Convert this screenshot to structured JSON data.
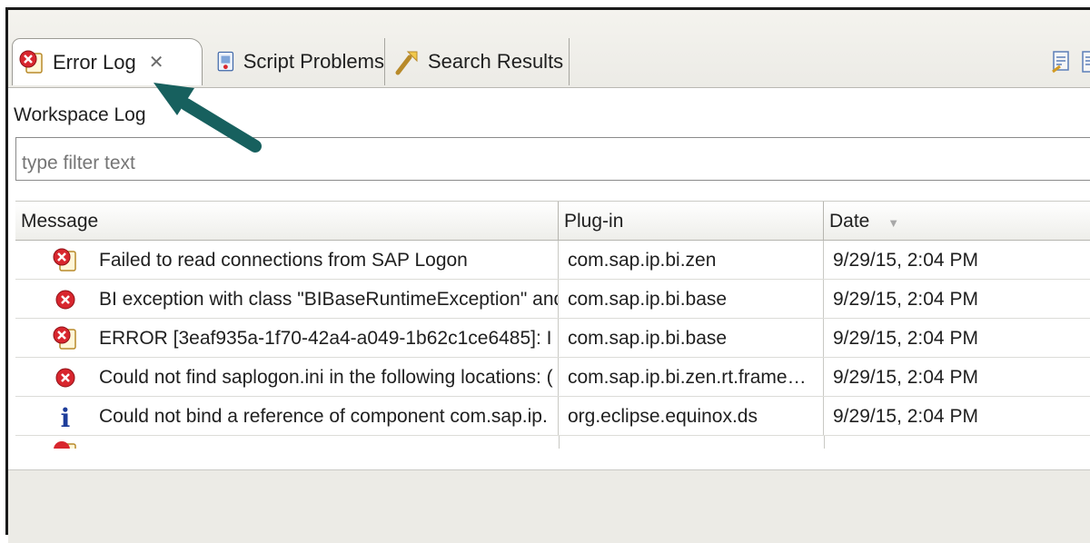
{
  "tabs": [
    {
      "label": "Error Log",
      "icon": "error-log-icon",
      "active": true
    },
    {
      "label": "Script Problems",
      "icon": "script-problems-icon",
      "active": false
    },
    {
      "label": "Search Results",
      "icon": "search-results-icon",
      "active": false
    }
  ],
  "close_glyph": "✕",
  "panel_title": "Workspace Log",
  "filter": {
    "placeholder": "type filter text",
    "value": ""
  },
  "table": {
    "columns": [
      "Message",
      "Plug-in",
      "Date"
    ],
    "sort_indicator": "▼",
    "rows": [
      {
        "severity": "error-log-entry",
        "message": "Failed to read connections from SAP Logon",
        "plugin": "com.sap.ip.bi.zen",
        "date": "9/29/15, 2:04 PM"
      },
      {
        "severity": "error",
        "message": "BI exception with class \"BIBaseRuntimeException\" and",
        "plugin": "com.sap.ip.bi.base",
        "date": "9/29/15, 2:04 PM"
      },
      {
        "severity": "error-log-entry",
        "message": "ERROR [3eaf935a-1f70-42a4-a049-1b62c1ce6485]: I",
        "plugin": "com.sap.ip.bi.base",
        "date": "9/29/15, 2:04 PM"
      },
      {
        "severity": "error",
        "message": "Could not find saplogon.ini in the following locations: (",
        "plugin": "com.sap.ip.bi.zen.rt.frame…",
        "date": "9/29/15, 2:04 PM"
      },
      {
        "severity": "info",
        "message": "Could not bind a reference of component com.sap.ip.",
        "plugin": "org.eclipse.equinox.ds",
        "date": "9/29/15, 2:04 PM"
      }
    ]
  },
  "colors": {
    "error": "#d8262e",
    "info": "#1d3c9a",
    "annotation_arrow": "#17605e"
  }
}
